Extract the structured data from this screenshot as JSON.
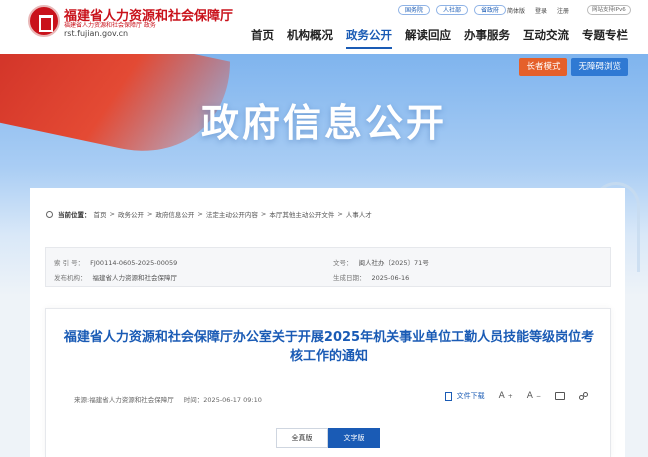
{
  "header": {
    "site_title": "福建省人力资源和社会保障厅",
    "site_sub": "福建省人力资源和社会保障厅 政务",
    "site_url": "rst.fujian.gov.cn",
    "top_links": [
      "国务院",
      "人社部",
      "省政府"
    ],
    "util_links": [
      "简体版",
      "登录",
      "注册"
    ],
    "ipv6": "网站支持IPv6",
    "nav": [
      "首页",
      "机构概况",
      "政务公开",
      "解读回应",
      "办事服务",
      "互动交流",
      "专题专栏"
    ],
    "nav_active_index": 2
  },
  "banner": {
    "title": "政府信息公开",
    "elder_mode": "长者模式",
    "accessible_mode": "无障碍浏览"
  },
  "breadcrumb": {
    "label": "当前位置：",
    "items": [
      "首页",
      "政务公开",
      "政府信息公开",
      "法定主动公开内容",
      "本厅其他主动公开文件",
      "人事人才"
    ],
    "separator": ">"
  },
  "meta": {
    "index_key": "索 引 号：",
    "index_val": "FJ00114-0605-2025-00059",
    "doc_key": "文号：",
    "doc_val": "闽人社办〔2025〕71号",
    "org_key": "发布机构：",
    "org_val": "福建省人力资源和社会保障厅",
    "date_key": "生成日期：",
    "date_val": "2025-06-16"
  },
  "article": {
    "title": "福建省人力资源和社会保障厅办公室关于开展2025年机关事业单位工勤人员技能等级岗位考核工作的通知",
    "source": "来源:福建省人力资源和社会保障厅",
    "time": "时间：2025-06-17 09:10",
    "download": "文件下载",
    "font_up": "A",
    "font_down": "A",
    "version_tabs": [
      "全真版",
      "文字版"
    ],
    "active_version": 1
  }
}
